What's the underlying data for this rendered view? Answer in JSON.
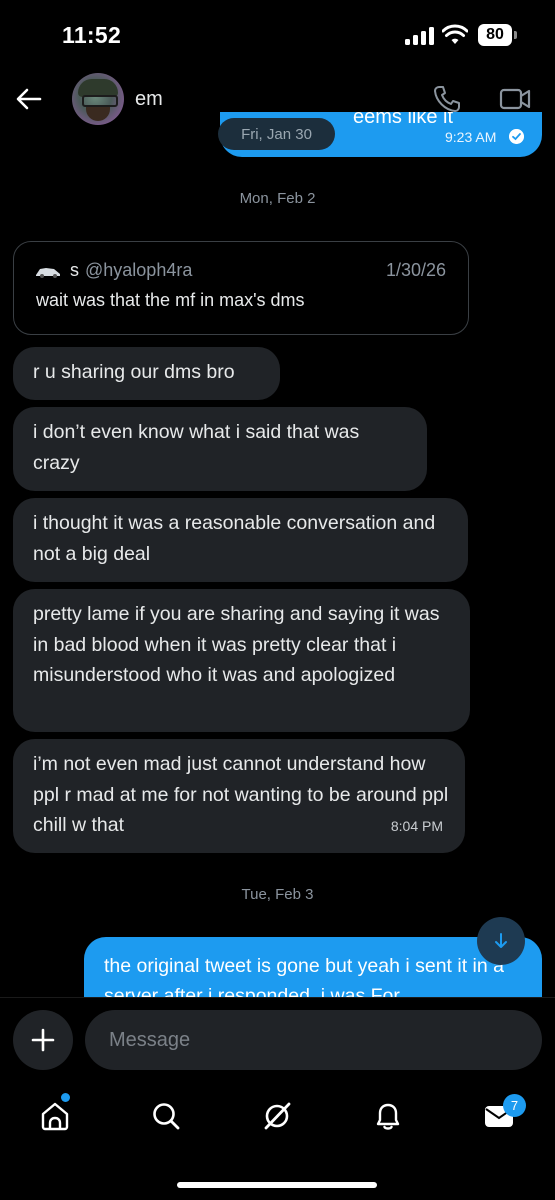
{
  "status_bar": {
    "time": "11:52",
    "battery": "80"
  },
  "header": {
    "contact_name": "em"
  },
  "top_message": {
    "visible_text": "eems like it",
    "time": "9:23 AM",
    "date_chip": "Fri, Jan 30"
  },
  "date_separators": [
    "Mon, Feb 2",
    "Tue, Feb 3"
  ],
  "quoted_tweet": {
    "display_name": "s",
    "handle": "@hyaloph4ra",
    "date": "1/30/26",
    "text": "wait was that the mf in max's dms"
  },
  "incoming_messages": [
    {
      "text": "r u sharing our dms bro"
    },
    {
      "text": "i don’t even know what i said that was crazy"
    },
    {
      "text": "i thought it was a reasonable conversation and not a big deal"
    },
    {
      "text": "pretty lame if you are sharing and saying it was in bad blood when it was pretty clear that i misunderstood who it was and apologized"
    },
    {
      "text": "i’m not even mad just cannot understand how ppl r mad at me for not wanting to be around ppl chill w that",
      "time": "8:04 PM"
    }
  ],
  "outgoing_message": {
    "text": "the original tweet is gone but yeah i sent it in a server after i responded. i was For"
  },
  "composer": {
    "placeholder": "Message"
  },
  "tab_bar": {
    "tabs": [
      "home-icon",
      "search-icon",
      "grok-icon",
      "notifications-icon",
      "messages-icon"
    ],
    "messages_badge": "7"
  },
  "colors": {
    "accent": "#1d9bf0",
    "bubble_incoming": "#202327",
    "background": "#000000"
  }
}
